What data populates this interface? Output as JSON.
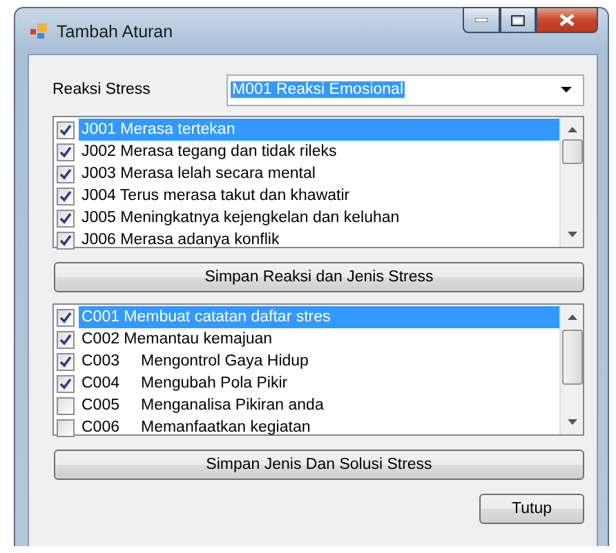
{
  "window": {
    "title": "Tambah Aturan"
  },
  "reaksi": {
    "label": "Reaksi Stress",
    "value": "M001 Reaksi Emosional"
  },
  "jenis_list": [
    {
      "text": "J001 Merasa tertekan",
      "checked": true,
      "selected": true
    },
    {
      "text": "J002 Merasa tegang dan tidak rileks",
      "checked": true,
      "selected": false
    },
    {
      "text": "J003 Merasa lelah secara mental",
      "checked": true,
      "selected": false
    },
    {
      "text": "J004 Terus merasa takut dan khawatir",
      "checked": true,
      "selected": false
    },
    {
      "text": "J005 Meningkatnya kejengkelan dan keluhan",
      "checked": true,
      "selected": false
    },
    {
      "text": "J006 Merasa adanya konflik",
      "checked": true,
      "selected": false
    }
  ],
  "save_reaksi_button": "Simpan Reaksi dan Jenis Stress",
  "solusi_list": [
    {
      "text": "C001 Membuat catatan daftar stres",
      "checked": true,
      "selected": true
    },
    {
      "text": "C002 Memantau kemajuan",
      "checked": true,
      "selected": false
    },
    {
      "text": "C003\tMengontrol Gaya Hidup",
      "checked": true,
      "selected": false
    },
    {
      "text": "C004\tMengubah Pola Pikir",
      "checked": true,
      "selected": false
    },
    {
      "text": "C005\tMenganalisa Pikiran anda",
      "checked": false,
      "selected": false
    },
    {
      "text": "C006\tMemanfaatkan kegiatan",
      "checked": false,
      "selected": false
    }
  ],
  "save_solusi_button": "Simpan Jenis Dan Solusi Stress",
  "close_button": "Tutup"
}
